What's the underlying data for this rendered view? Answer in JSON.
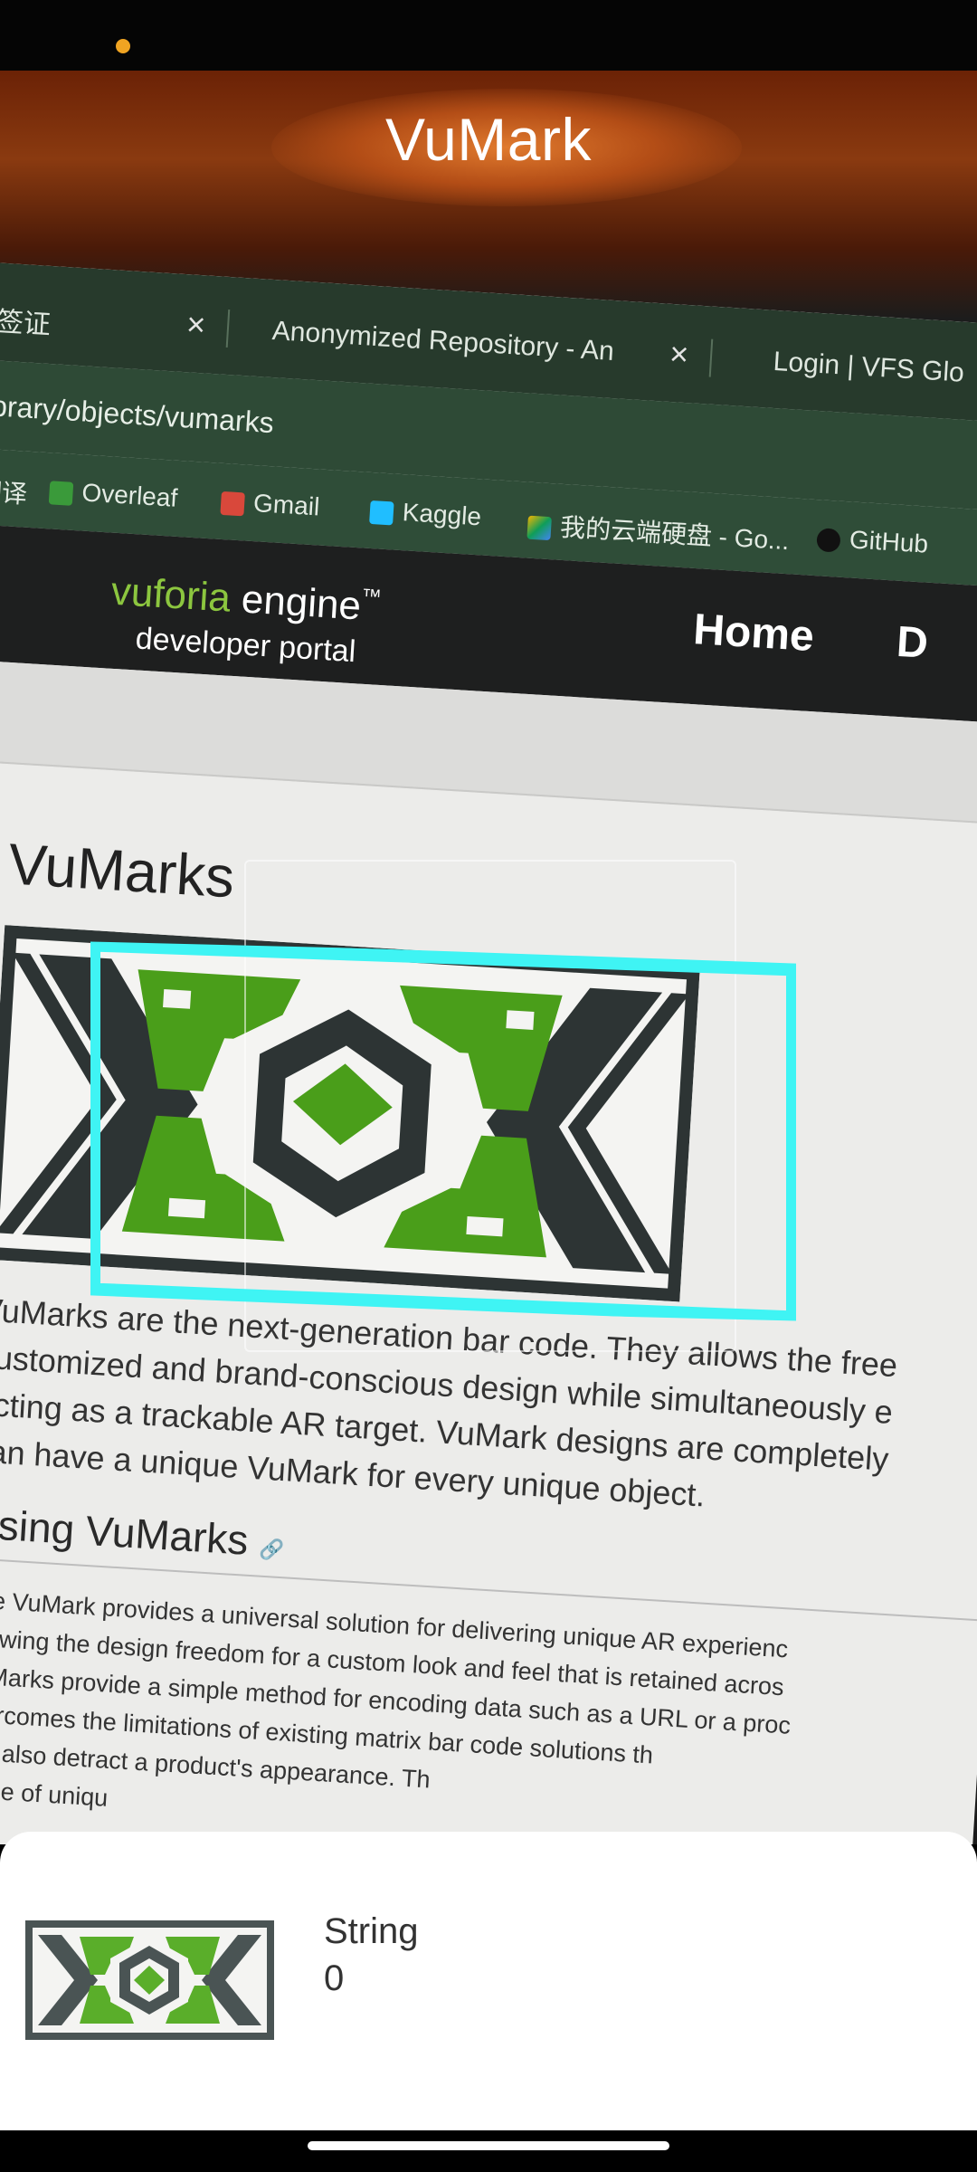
{
  "status_bar": {
    "indicator_color": "#f0a422"
  },
  "app": {
    "title": "VuMark"
  },
  "browser": {
    "tabs": [
      {
        "label": "…签证"
      },
      {
        "label": "Anonymized Repository - An"
      },
      {
        "label": "Login | VFS Glo"
      }
    ],
    "url": "brary/objects/vumarks",
    "bookmarks": [
      {
        "label": "le 翻译",
        "icon": "translate-icon"
      },
      {
        "label": "Overleaf",
        "icon": "overleaf-icon"
      },
      {
        "label": "Gmail",
        "icon": "gmail-icon"
      },
      {
        "label": "Kaggle",
        "icon": "kaggle-icon"
      },
      {
        "label": "我的云端硬盘 - Go...",
        "icon": "google-drive-icon"
      },
      {
        "label": "GitHub",
        "icon": "github-icon"
      }
    ]
  },
  "site": {
    "logo_brand": "vuforia",
    "logo_product": "engine",
    "logo_tm": "™",
    "logo_subtitle": "developer portal",
    "nav": [
      {
        "label": "Home"
      },
      {
        "label": "D"
      }
    ],
    "page_title": "VuMarks",
    "intro_lines": [
      "VuMarks are the next-generation bar code. They allows the free",
      "customized and brand-conscious design while simultaneously e",
      "acting as a trackable AR target. VuMark designs are completely",
      "can have a unique VuMark for every unique object."
    ],
    "section_heading": "Using VuMarks",
    "section_lines": [
      "The VuMark provides a universal solution for delivering unique AR experienc",
      "allowing the design freedom for a custom look and feel that is retained acros",
      "VuMarks provide a simple method for encoding data such as a URL or a proc",
      "overcomes the limitations of existing matrix bar code solutions th",
      "and also detract a product's appearance. Th",
      "range of uniqu"
    ]
  },
  "colors": {
    "tracking_outline": "#3ff4f4",
    "vumark_green": "#4a9e1a",
    "vumark_dark": "#2d3434"
  },
  "result_sheet": {
    "type_label": "String",
    "value": "0",
    "thumbnail_icon": "vumark-thumbnail-icon"
  }
}
